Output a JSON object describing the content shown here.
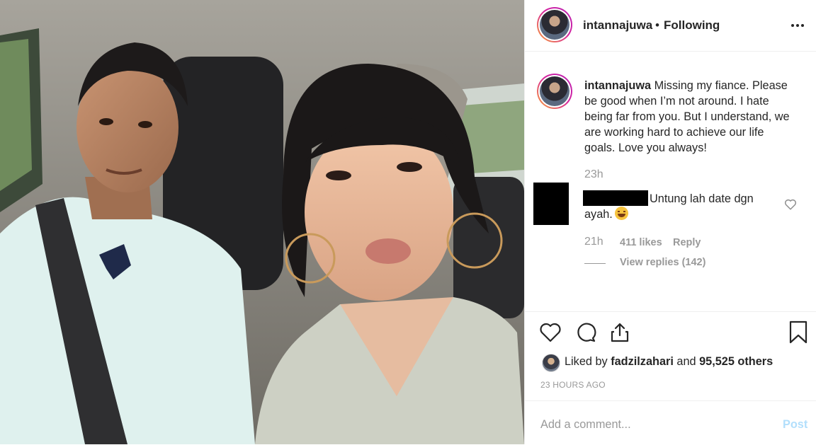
{
  "header": {
    "username": "intannajuwa",
    "separator": "•",
    "follow_status": "Following"
  },
  "caption": {
    "username": "intannajuwa",
    "text": "Missing my fiance. Please be good when I’m not around. I hate being far from you. But I understand, we are working hard to achieve our life goals. Love you always!",
    "time": "23h"
  },
  "comment": {
    "text": "Untung lah date dgn ayah.",
    "time": "21h",
    "likes": "411 likes",
    "reply_label": "Reply",
    "view_replies": "View replies (142)"
  },
  "likes_line": {
    "prefix": "Liked by",
    "user": "fadzilzahari",
    "middle": "and",
    "count": "95,525 others"
  },
  "timestamp": "23 HOURS AGO",
  "comment_box": {
    "placeholder": "Add a comment...",
    "post_label": "Post"
  },
  "icons": {
    "more": "more-options-icon",
    "like": "heart-icon",
    "comment": "comment-icon",
    "share": "share-icon",
    "save": "bookmark-icon",
    "comment_like": "small-heart-icon"
  },
  "colors": {
    "text": "#262626",
    "muted": "#999999",
    "post_disabled": "#b2dffc",
    "divider": "#efefef"
  }
}
